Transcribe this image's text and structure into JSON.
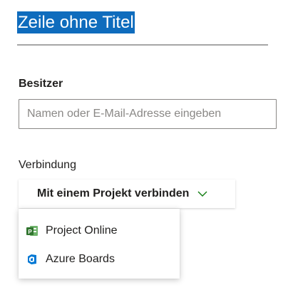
{
  "title": "Zeile ohne Titel",
  "owner": {
    "label": "Besitzer",
    "placeholder": "Namen oder E-Mail-Adresse eingeben",
    "value": ""
  },
  "connection": {
    "label": "Verbindung",
    "button_label": "Mit einem Projekt verbinden",
    "menu_items": [
      {
        "label": "Project Online",
        "icon": "project-online-icon"
      },
      {
        "label": "Azure Boards",
        "icon": "azure-boards-icon"
      }
    ]
  },
  "colors": {
    "selection": "#0f6cbd",
    "chevron": "#107c10",
    "project_online": "#31752f",
    "azure_boards": "#0078d4"
  }
}
